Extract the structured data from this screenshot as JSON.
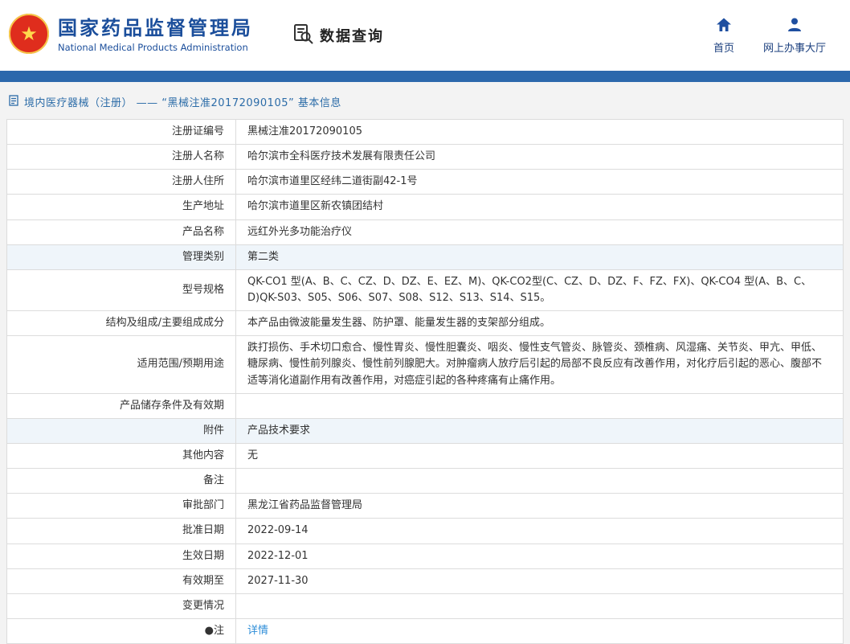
{
  "colors": {
    "accent_blue": "#2c68ac",
    "logo_blue": "#1b4e9b",
    "nav_text_blue": "#1b3f7e",
    "breadcrumb_blue": "#2c6ca8",
    "link_blue": "#2e8ed8",
    "row_highlight": "#eff5fa"
  },
  "header": {
    "logo": {
      "title": "国家药品监督管理局",
      "subtitle": "National Medical Products Administration",
      "emblem_icon": "national-emblem-icon"
    },
    "module": {
      "label": "数据查询",
      "icon": "data-query-icon"
    },
    "nav": [
      {
        "label": "首页",
        "icon": "home-icon"
      },
      {
        "label": "网上办事大厅",
        "icon": "person-icon"
      }
    ]
  },
  "breadcrumb": {
    "icon": "document-icon",
    "text": "境内医疗器械（注册） —— “黑械注准20172090105” 基本信息"
  },
  "table": {
    "rows": [
      {
        "label": "注册证编号",
        "value": "黑械注准20172090105",
        "highlight": false,
        "link": false
      },
      {
        "label": "注册人名称",
        "value": "哈尔滨市全科医疗技术发展有限责任公司",
        "highlight": false,
        "link": false
      },
      {
        "label": "注册人住所",
        "value": "哈尔滨市道里区经纬二道街副42-1号",
        "highlight": false,
        "link": false
      },
      {
        "label": "生产地址",
        "value": "哈尔滨市道里区新农镇团结村",
        "highlight": false,
        "link": false
      },
      {
        "label": "产品名称",
        "value": "远红外光多功能治疗仪",
        "highlight": false,
        "link": false
      },
      {
        "label": "管理类别",
        "value": "第二类",
        "highlight": true,
        "link": false
      },
      {
        "label": "型号规格",
        "value": "QK-CO1 型(A、B、C、CZ、D、DZ、E、EZ、M)、QK-CO2型(C、CZ、D、DZ、F、FZ、FX)、QK-CO4 型(A、B、C、D)QK-S03、S05、S06、S07、S08、S12、S13、S14、S15。",
        "highlight": false,
        "link": false
      },
      {
        "label": "结构及组成/主要组成成分",
        "value": "本产品由微波能量发生器、防护罩、能量发生器的支架部分组成。",
        "highlight": false,
        "link": false
      },
      {
        "label": "适用范围/预期用途",
        "value": "跌打损伤、手术切口愈合、慢性胃炎、慢性胆囊炎、咽炎、慢性支气管炎、脉管炎、颈椎病、风湿痛、关节炎、甲亢、甲低、糖尿病、慢性前列腺炎、慢性前列腺肥大。对肿瘤病人放疗后引起的局部不良反应有改善作用，对化疗后引起的恶心、腹部不适等消化道副作用有改善作用，对癌症引起的各种疼痛有止痛作用。",
        "highlight": false,
        "link": false
      },
      {
        "label": "产品储存条件及有效期",
        "value": "",
        "highlight": false,
        "link": false
      },
      {
        "label": "附件",
        "value": "产品技术要求",
        "highlight": true,
        "link": false
      },
      {
        "label": "其他内容",
        "value": "无",
        "highlight": false,
        "link": false
      },
      {
        "label": "备注",
        "value": "",
        "highlight": false,
        "link": false
      },
      {
        "label": "审批部门",
        "value": "黑龙江省药品监督管理局",
        "highlight": false,
        "link": false
      },
      {
        "label": "批准日期",
        "value": "2022-09-14",
        "highlight": false,
        "link": false
      },
      {
        "label": "生效日期",
        "value": "2022-12-01",
        "highlight": false,
        "link": false
      },
      {
        "label": "有效期至",
        "value": "2027-11-30",
        "highlight": false,
        "link": false
      },
      {
        "label": "变更情况",
        "value": "",
        "highlight": false,
        "link": false
      },
      {
        "label": "●注",
        "value": "详情",
        "highlight": false,
        "link": true
      }
    ]
  }
}
